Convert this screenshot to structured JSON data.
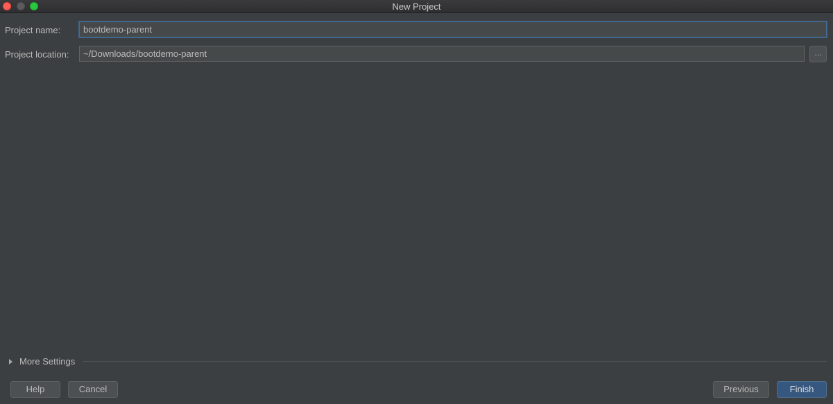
{
  "window": {
    "title": "New Project"
  },
  "form": {
    "project_name_label": "Project name:",
    "project_name_value": "bootdemo-parent",
    "project_location_label": "Project location:",
    "project_location_value": "~/Downloads/bootdemo-parent",
    "browse_label": "..."
  },
  "more_settings": {
    "label": "More Settings",
    "expanded": false
  },
  "buttons": {
    "help": "Help",
    "cancel": "Cancel",
    "previous": "Previous",
    "finish": "Finish"
  },
  "colors": {
    "background": "#3c3f41",
    "default_button": "#365880",
    "focus_border": "#466d94"
  },
  "icons": {
    "close": "close-icon",
    "minimize": "minimize-icon",
    "zoom": "zoom-icon",
    "disclosure": "chevron-right-icon"
  }
}
